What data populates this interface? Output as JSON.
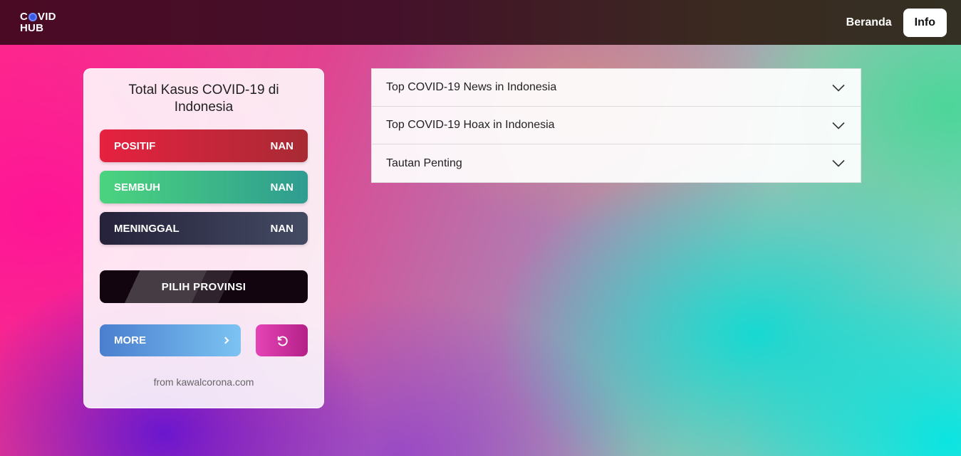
{
  "header": {
    "logo_line1_a": "C",
    "logo_line1_b": "VID",
    "logo_line2": "HUB",
    "nav_home": "Beranda",
    "nav_info": "Info"
  },
  "card": {
    "title": "Total Kasus COVID-19 di Indonesia",
    "stats": [
      {
        "label": "POSITIF",
        "value": "NAN"
      },
      {
        "label": "SEMBUH",
        "value": "NAN"
      },
      {
        "label": "MENINGGAL",
        "value": "NAN"
      }
    ],
    "province_button": "PILIH PROVINSI",
    "more_button": "MORE",
    "source": "from kawalcorona.com"
  },
  "accordion": {
    "items": [
      {
        "label": "Top COVID-19 News in Indonesia"
      },
      {
        "label": "Top COVID-19 Hoax in Indonesia"
      },
      {
        "label": "Tautan Penting"
      }
    ]
  },
  "colors": {
    "positive": "#e62240",
    "recovered": "#4bd47f",
    "deaths": "#25223a",
    "more": "#4a7fcf",
    "reset": "#e544b6"
  }
}
